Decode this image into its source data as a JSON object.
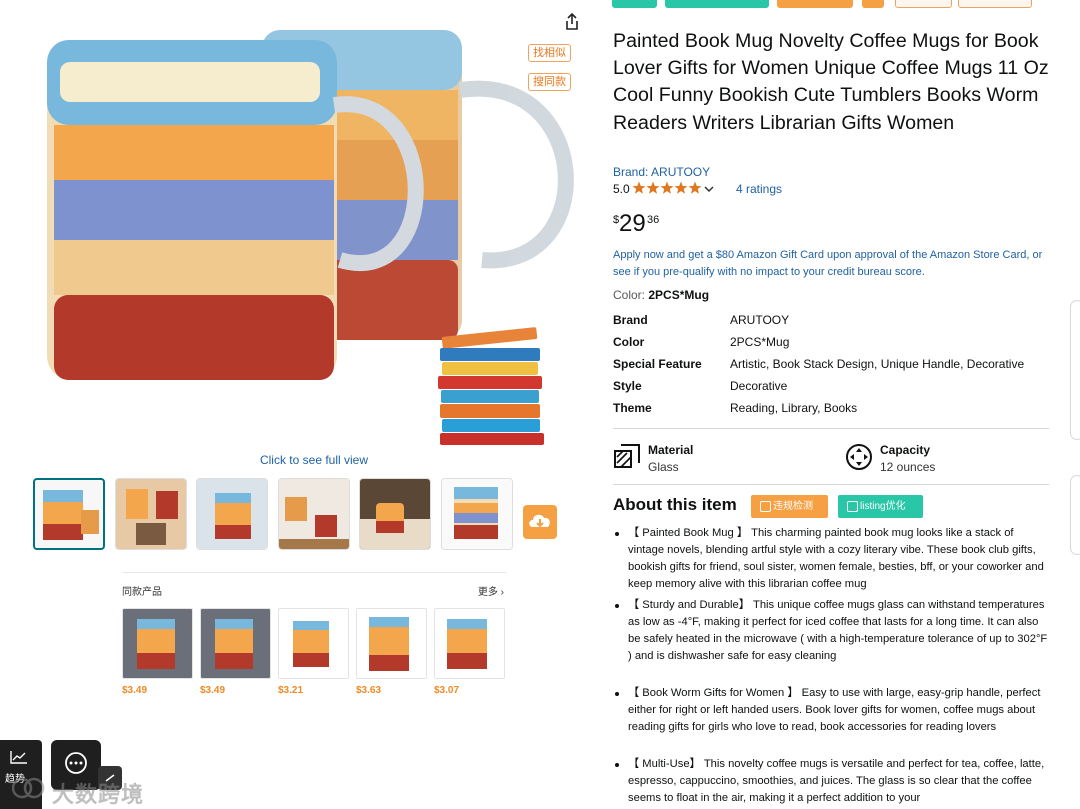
{
  "gallery": {
    "image_tags": [
      "找相似",
      "搜同款"
    ],
    "full_view_text": "Click to see full view",
    "thumbnail_count": 6,
    "same_products": {
      "title": "同款产品",
      "more_label": "更多",
      "items": [
        {
          "price": "$3.49"
        },
        {
          "price": "$3.49"
        },
        {
          "price": "$3.21"
        },
        {
          "price": "$3.63"
        },
        {
          "price": "$3.07"
        }
      ]
    }
  },
  "product": {
    "title": "Painted Book Mug Novelty Coffee Mugs for Book Lover Gifts for Women Unique Coffee Mugs 11 Oz Cool Funny Bookish Cute Tumblers Books Worm Readers Writers Librarian Gifts Women",
    "brand_link": "Brand: ARUTOOY",
    "rating_value": "5.0",
    "ratings_count": "4 ratings",
    "price": {
      "symbol": "$",
      "whole": "29",
      "fraction": "36"
    },
    "promo": "Apply now and get a $80 Amazon Gift Card upon approval of the Amazon Store Card, or see if you pre-qualify with no impact to your credit bureau score.",
    "color_label": "Color:",
    "color_value": "2PCS*Mug",
    "specs": [
      {
        "key": "Brand",
        "value": "ARUTOOY"
      },
      {
        "key": "Color",
        "value": "2PCS*Mug"
      },
      {
        "key": "Special Feature",
        "value": "Artistic, Book Stack Design, Unique Handle, Decorative"
      },
      {
        "key": "Style",
        "value": "Decorative"
      },
      {
        "key": "Theme",
        "value": "Reading, Library, Books"
      }
    ],
    "features": [
      {
        "label": "Material",
        "value": "Glass",
        "icon": "material-icon"
      },
      {
        "label": "Capacity",
        "value": "12 ounces",
        "icon": "capacity-icon"
      }
    ]
  },
  "about": {
    "title": "About this item",
    "button_violation": "违规检测",
    "button_listing": "listing优化",
    "bullets": [
      "【 Painted Book Mug 】 This charming painted book mug looks like a stack of vintage novels, blending artful style with a cozy literary vibe. These book club gifts, bookish gifts for friend, soul sister, women female, besties, bff, or your coworker and keep memory alive with this librarian coffee mug",
      "【 Sturdy and Durable】 This unique coffee mugs glass can withstand temperatures as low as -4°F, making it perfect for iced coffee that lasts for a long time. It can also be safely heated in the microwave ( with a high-temperature tolerance of up to 302°F ) and is dishwasher safe for easy cleaning",
      "【 Book Worm Gifts for Women 】 Easy to use with large, easy-grip handle, perfect either for right or left handed users. Book lover gifts for women, coffee mugs about reading gifts for girls who love to read, book accessories for reading lovers",
      "【 Multi-Use】 This novelty coffee mugs is versatile and perfect for tea, coffee, latte, espresso, cappuccino, smoothies, and juices. The glass is so clear that the coffee seems to float in the air, making it a perfect addition to your"
    ]
  },
  "widgets": {
    "trend_label": "趋势",
    "watermark": "大数跨境"
  },
  "colors": {
    "link": "#2162a1",
    "star": "#de7921",
    "orange_button": "#f5a042",
    "teal_button": "#29c7a8",
    "price_orange": "#f08a24"
  }
}
